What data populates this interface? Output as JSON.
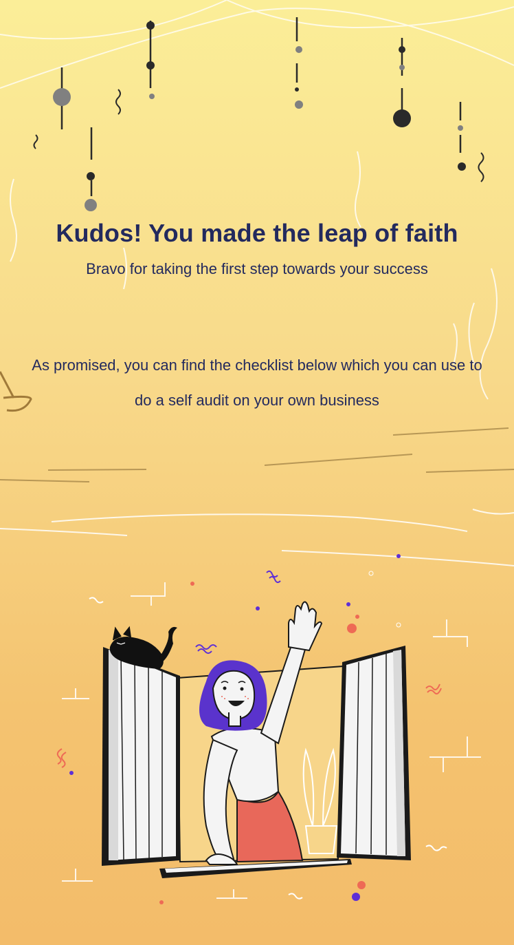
{
  "header": {
    "title": "Kudos! You made the leap of faith",
    "subtitle": "Bravo for taking the first step towards your success"
  },
  "main": {
    "message": "As promised, you can find the checklist below which you can use to do a self audit on your own business"
  },
  "illustration": {
    "subject": "woman-waving-from-open-window-with-cat",
    "colors": {
      "hair": "#5a33cc",
      "skirt": "#e8685a",
      "text": "#232a5e",
      "confetti_orange": "#ee6a55",
      "confetti_purple": "#5e2fd6"
    }
  }
}
